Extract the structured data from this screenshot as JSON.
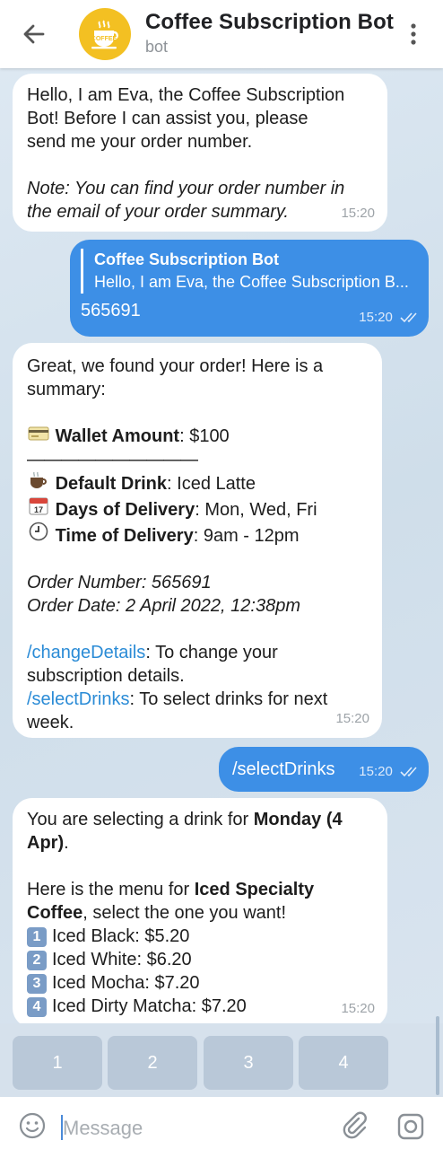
{
  "header": {
    "title": "Coffee Subscription Bot",
    "subtitle": "bot"
  },
  "messages": {
    "m1": {
      "lines": [
        "Hello, I am Eva, the Coffee Subscription",
        "Bot! Before I can assist you, please",
        "send me your order number."
      ],
      "note": [
        "Note: You can find your order number in",
        "the email of your order summary."
      ],
      "time": "15:20"
    },
    "m2": {
      "reply_name": "Coffee Subscription Bot",
      "reply_text": "Hello, I am Eva, the Coffee Subscription B...",
      "text": "565691",
      "time": "15:20"
    },
    "m3": {
      "intro": [
        "Great, we found your order! Here is a",
        "summary:"
      ],
      "wallet_label": "Wallet Amount",
      "wallet_value": ": $100",
      "divider": "——————————",
      "drink_label": "Default Drink",
      "drink_value": ": Iced Latte",
      "days_label": "Days of Delivery",
      "days_value": ": Mon, Wed, Fri",
      "time_label": "Time of Delivery",
      "time_value": ": 9am - 12pm",
      "order_number": "Order Number: 565691",
      "order_date": "Order Date: 2 April 2022, 12:38pm",
      "cmd1": "/changeDetails",
      "cmd1_text": ": To change your",
      "cmd1_text2": "subscription details.",
      "cmd2": "/selectDrinks",
      "cmd2_text": ": To select drinks for next",
      "cmd2_text2": "week.",
      "time": "15:20"
    },
    "m4": {
      "text": "/selectDrinks",
      "time": "15:20"
    },
    "m5": {
      "l1_pre": "You are selecting a drink for ",
      "l1_bold": "Monday (4",
      "l2_bold": "Apr)",
      "l2_post": ".",
      "l3_pre": "Here is the menu for ",
      "l3_bold": "Iced Specialty",
      "l4_bold": "Coffee",
      "l4_post": ", select the one you want!",
      "items": [
        {
          "num": "1",
          "text": "Iced Black: $5.20"
        },
        {
          "num": "2",
          "text": "Iced White: $6.20"
        },
        {
          "num": "3",
          "text": "Iced Mocha: $7.20"
        },
        {
          "num": "4",
          "text": "Iced Dirty Matcha: $7.20"
        }
      ],
      "time": "15:20"
    }
  },
  "keyboard": [
    "1",
    "2",
    "3",
    "4"
  ],
  "input": {
    "placeholder": "Message"
  },
  "colors": {
    "accent": "#3d8fe6",
    "link": "#2a8bd6",
    "avatar": "#f3c022"
  }
}
